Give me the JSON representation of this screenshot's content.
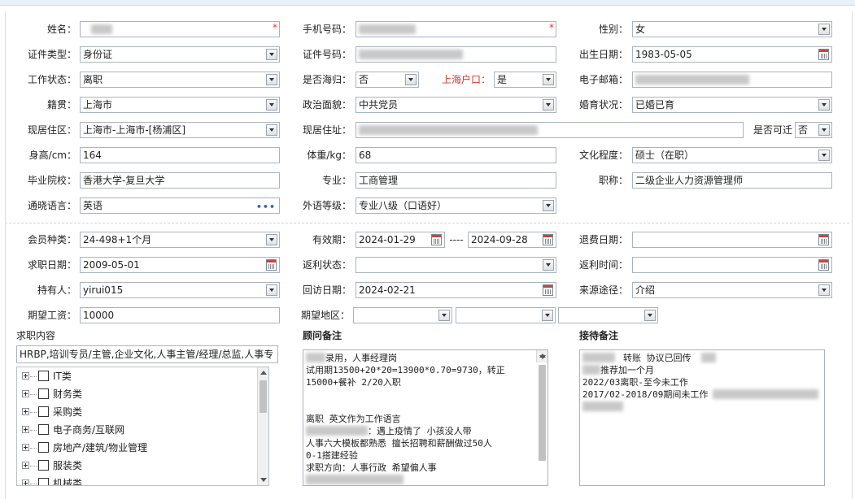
{
  "form": {
    "name_label": "姓名：",
    "name_value": "",
    "phone_label": "手机号码：",
    "phone_value": "",
    "gender_label": "性别：",
    "gender_value": "女",
    "id_type_label": "证件类型：",
    "id_type_value": "身份证",
    "id_no_label": "证件号码：",
    "id_no_value": "",
    "birth_label": "出生日期：",
    "birth_value": "1983-05-05",
    "work_status_label": "工作状态：",
    "work_status_value": "离职",
    "overseas_label": "是否海归：",
    "overseas_value": "否",
    "shanghai_hukou_label": "上海户口：",
    "shanghai_hukou_value": "是",
    "email_label": "电子邮箱：",
    "email_value": "",
    "native_label": "籍贯：",
    "native_value": "上海市",
    "political_label": "政治面貌：",
    "political_value": "中共党员",
    "marital_label": "婚育状况：",
    "marital_value": "已婚已育",
    "residence_area_label": "现居住区：",
    "residence_area_value": "上海市-上海市-[杨浦区]",
    "residence_addr_label": "现居住址：",
    "residence_addr_value": "",
    "relocate_label": "是否可迁",
    "relocate_value": "否",
    "height_label": "身高/cm：",
    "height_value": "164",
    "weight_label": "体重/kg：",
    "weight_value": "68",
    "education_label": "文化程度：",
    "education_value": "硕士（在职）",
    "school_label": "毕业院校：",
    "school_value": "香港大学-复旦大学",
    "major_label": "专业：",
    "major_value": "工商管理",
    "title_label": "职称：",
    "title_value": "二级企业人力资源管理师",
    "language_label": "通晓语言：",
    "language_value": "英语",
    "language_more": "•••",
    "fl_level_label": "外语等级：",
    "fl_level_value": "专业八级（口语好）"
  },
  "membership": {
    "member_type_label": "会员种类：",
    "member_type_value": "24-498+1个月",
    "valid_label": "有效期：",
    "valid_from": "2024-01-29",
    "valid_sep": "----",
    "valid_to": "2024-09-28",
    "refund_date_label": "退费日期：",
    "refund_date_value": "",
    "job_date_label": "求职日期：",
    "job_date_value": "2009-05-01",
    "rebate_status_label": "返利状态：",
    "rebate_status_value": "",
    "rebate_time_label": "返利时间：",
    "rebate_time_value": "",
    "holder_label": "持有人：",
    "holder_value": "yirui015",
    "visit_date_label": "回访日期：",
    "visit_date_value": "2024-02-21",
    "source_label": "来源途径：",
    "source_value": "介绍",
    "salary_label": "期望工资：",
    "salary_value": "10000",
    "region_label": "期望地区：",
    "region_values": [
      "",
      "",
      ""
    ]
  },
  "job_content": {
    "title": "求职内容",
    "text": "HRBP,培训专员/主管,企业文化,人事主管/经理/总监,人事专",
    "categories": [
      "IT类",
      "财务类",
      "采购类",
      "电子商务/互联网",
      "房地产/建筑/物业管理",
      "服装类",
      "机械类"
    ]
  },
  "advisor_notes": {
    "title": "顾问备注",
    "lines": [
      "录用，人事经理岗",
      "试用期13500+20*20=13900*0.70=9730，转正",
      "15000+餐补  2/20入职",
      "",
      "",
      "离职 英文作为工作语言",
      "：遇上疫情了 小孩没人带",
      "人事六大模板都熟悉 擅长招聘和薪酬做过50人",
      "0-1搭建经验",
      "求职方向：人事行政 希望偏人事",
      ""
    ]
  },
  "reception_notes": {
    "title": "接待备注",
    "lines": [
      "转账  协议已回传",
      "推荐加一个月",
      "2022/03离职-至今未工作",
      "2017/02-2018/09期间未工作",
      ""
    ]
  }
}
